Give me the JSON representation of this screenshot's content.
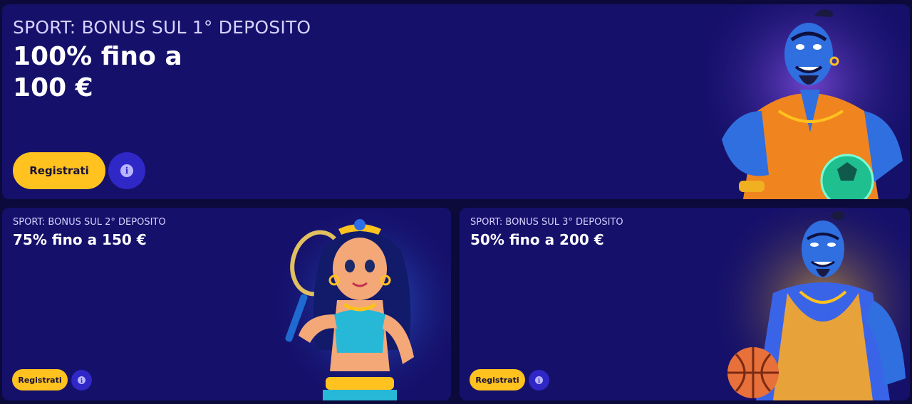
{
  "cards": [
    {
      "subtitle": "SPORT: BONUS SUL 1° DEPOSITO",
      "title": "100% fino a 100 €",
      "register_label": "Registrati",
      "info_label": "i",
      "illustration": "genie-with-soccer-ball"
    },
    {
      "subtitle": "SPORT: BONUS SUL 2° DEPOSITO",
      "title": "75% fino a 150 €",
      "register_label": "Registrati",
      "info_label": "i",
      "illustration": "princess-with-tennis-racket"
    },
    {
      "subtitle": "SPORT: BONUS SUL 3° DEPOSITO",
      "title": "50% fino a 200 €",
      "register_label": "Registrati",
      "info_label": "i",
      "illustration": "genie-with-basketball"
    }
  ],
  "colors": {
    "page_background": "#0c0a3a",
    "card_background": "#15106a",
    "register_button": "#ffc21e",
    "info_button": "#3027c7",
    "subtitle_text": "#d6d2ff"
  }
}
